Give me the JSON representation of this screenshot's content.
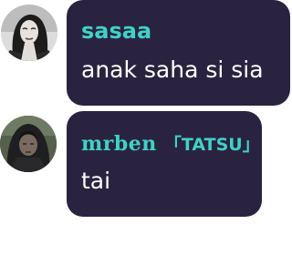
{
  "messages": [
    {
      "author": "sasaa",
      "text": "anak saha si sia",
      "avatar": "woman-portrait-bw-avatar"
    },
    {
      "author_name": "mrben",
      "author_tag": "「TATSU」",
      "text": "tai",
      "avatar": "hooded-person-dark-avatar"
    }
  ],
  "colors": {
    "bubble": "#2a2340",
    "author": "#3fd2c7",
    "text": "#ffffff",
    "background": "#ffffff"
  }
}
